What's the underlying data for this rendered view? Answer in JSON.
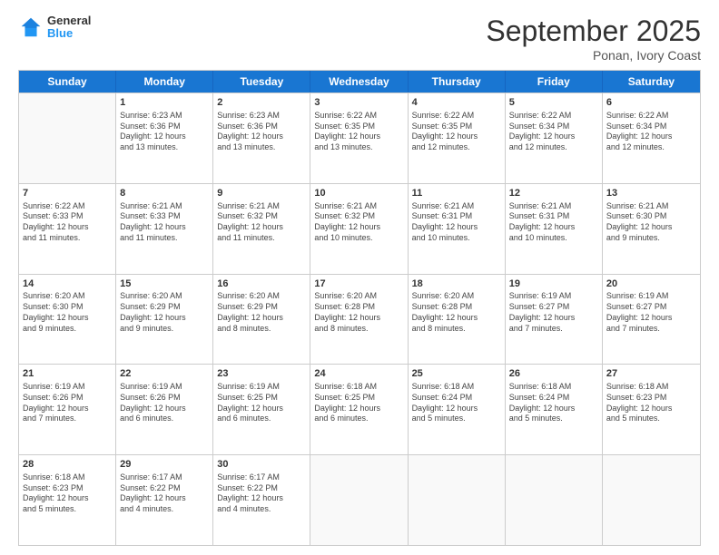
{
  "header": {
    "logo_line1": "General",
    "logo_line2": "Blue",
    "month": "September 2025",
    "location": "Ponan, Ivory Coast"
  },
  "days": [
    "Sunday",
    "Monday",
    "Tuesday",
    "Wednesday",
    "Thursday",
    "Friday",
    "Saturday"
  ],
  "weeks": [
    [
      {
        "day": "",
        "info": ""
      },
      {
        "day": "1",
        "info": "Sunrise: 6:23 AM\nSunset: 6:36 PM\nDaylight: 12 hours\nand 13 minutes."
      },
      {
        "day": "2",
        "info": "Sunrise: 6:23 AM\nSunset: 6:36 PM\nDaylight: 12 hours\nand 13 minutes."
      },
      {
        "day": "3",
        "info": "Sunrise: 6:22 AM\nSunset: 6:35 PM\nDaylight: 12 hours\nand 13 minutes."
      },
      {
        "day": "4",
        "info": "Sunrise: 6:22 AM\nSunset: 6:35 PM\nDaylight: 12 hours\nand 12 minutes."
      },
      {
        "day": "5",
        "info": "Sunrise: 6:22 AM\nSunset: 6:34 PM\nDaylight: 12 hours\nand 12 minutes."
      },
      {
        "day": "6",
        "info": "Sunrise: 6:22 AM\nSunset: 6:34 PM\nDaylight: 12 hours\nand 12 minutes."
      }
    ],
    [
      {
        "day": "7",
        "info": "Sunrise: 6:22 AM\nSunset: 6:33 PM\nDaylight: 12 hours\nand 11 minutes."
      },
      {
        "day": "8",
        "info": "Sunrise: 6:21 AM\nSunset: 6:33 PM\nDaylight: 12 hours\nand 11 minutes."
      },
      {
        "day": "9",
        "info": "Sunrise: 6:21 AM\nSunset: 6:32 PM\nDaylight: 12 hours\nand 11 minutes."
      },
      {
        "day": "10",
        "info": "Sunrise: 6:21 AM\nSunset: 6:32 PM\nDaylight: 12 hours\nand 10 minutes."
      },
      {
        "day": "11",
        "info": "Sunrise: 6:21 AM\nSunset: 6:31 PM\nDaylight: 12 hours\nand 10 minutes."
      },
      {
        "day": "12",
        "info": "Sunrise: 6:21 AM\nSunset: 6:31 PM\nDaylight: 12 hours\nand 10 minutes."
      },
      {
        "day": "13",
        "info": "Sunrise: 6:21 AM\nSunset: 6:30 PM\nDaylight: 12 hours\nand 9 minutes."
      }
    ],
    [
      {
        "day": "14",
        "info": "Sunrise: 6:20 AM\nSunset: 6:30 PM\nDaylight: 12 hours\nand 9 minutes."
      },
      {
        "day": "15",
        "info": "Sunrise: 6:20 AM\nSunset: 6:29 PM\nDaylight: 12 hours\nand 9 minutes."
      },
      {
        "day": "16",
        "info": "Sunrise: 6:20 AM\nSunset: 6:29 PM\nDaylight: 12 hours\nand 8 minutes."
      },
      {
        "day": "17",
        "info": "Sunrise: 6:20 AM\nSunset: 6:28 PM\nDaylight: 12 hours\nand 8 minutes."
      },
      {
        "day": "18",
        "info": "Sunrise: 6:20 AM\nSunset: 6:28 PM\nDaylight: 12 hours\nand 8 minutes."
      },
      {
        "day": "19",
        "info": "Sunrise: 6:19 AM\nSunset: 6:27 PM\nDaylight: 12 hours\nand 7 minutes."
      },
      {
        "day": "20",
        "info": "Sunrise: 6:19 AM\nSunset: 6:27 PM\nDaylight: 12 hours\nand 7 minutes."
      }
    ],
    [
      {
        "day": "21",
        "info": "Sunrise: 6:19 AM\nSunset: 6:26 PM\nDaylight: 12 hours\nand 7 minutes."
      },
      {
        "day": "22",
        "info": "Sunrise: 6:19 AM\nSunset: 6:26 PM\nDaylight: 12 hours\nand 6 minutes."
      },
      {
        "day": "23",
        "info": "Sunrise: 6:19 AM\nSunset: 6:25 PM\nDaylight: 12 hours\nand 6 minutes."
      },
      {
        "day": "24",
        "info": "Sunrise: 6:18 AM\nSunset: 6:25 PM\nDaylight: 12 hours\nand 6 minutes."
      },
      {
        "day": "25",
        "info": "Sunrise: 6:18 AM\nSunset: 6:24 PM\nDaylight: 12 hours\nand 5 minutes."
      },
      {
        "day": "26",
        "info": "Sunrise: 6:18 AM\nSunset: 6:24 PM\nDaylight: 12 hours\nand 5 minutes."
      },
      {
        "day": "27",
        "info": "Sunrise: 6:18 AM\nSunset: 6:23 PM\nDaylight: 12 hours\nand 5 minutes."
      }
    ],
    [
      {
        "day": "28",
        "info": "Sunrise: 6:18 AM\nSunset: 6:23 PM\nDaylight: 12 hours\nand 5 minutes."
      },
      {
        "day": "29",
        "info": "Sunrise: 6:17 AM\nSunset: 6:22 PM\nDaylight: 12 hours\nand 4 minutes."
      },
      {
        "day": "30",
        "info": "Sunrise: 6:17 AM\nSunset: 6:22 PM\nDaylight: 12 hours\nand 4 minutes."
      },
      {
        "day": "",
        "info": ""
      },
      {
        "day": "",
        "info": ""
      },
      {
        "day": "",
        "info": ""
      },
      {
        "day": "",
        "info": ""
      }
    ]
  ]
}
